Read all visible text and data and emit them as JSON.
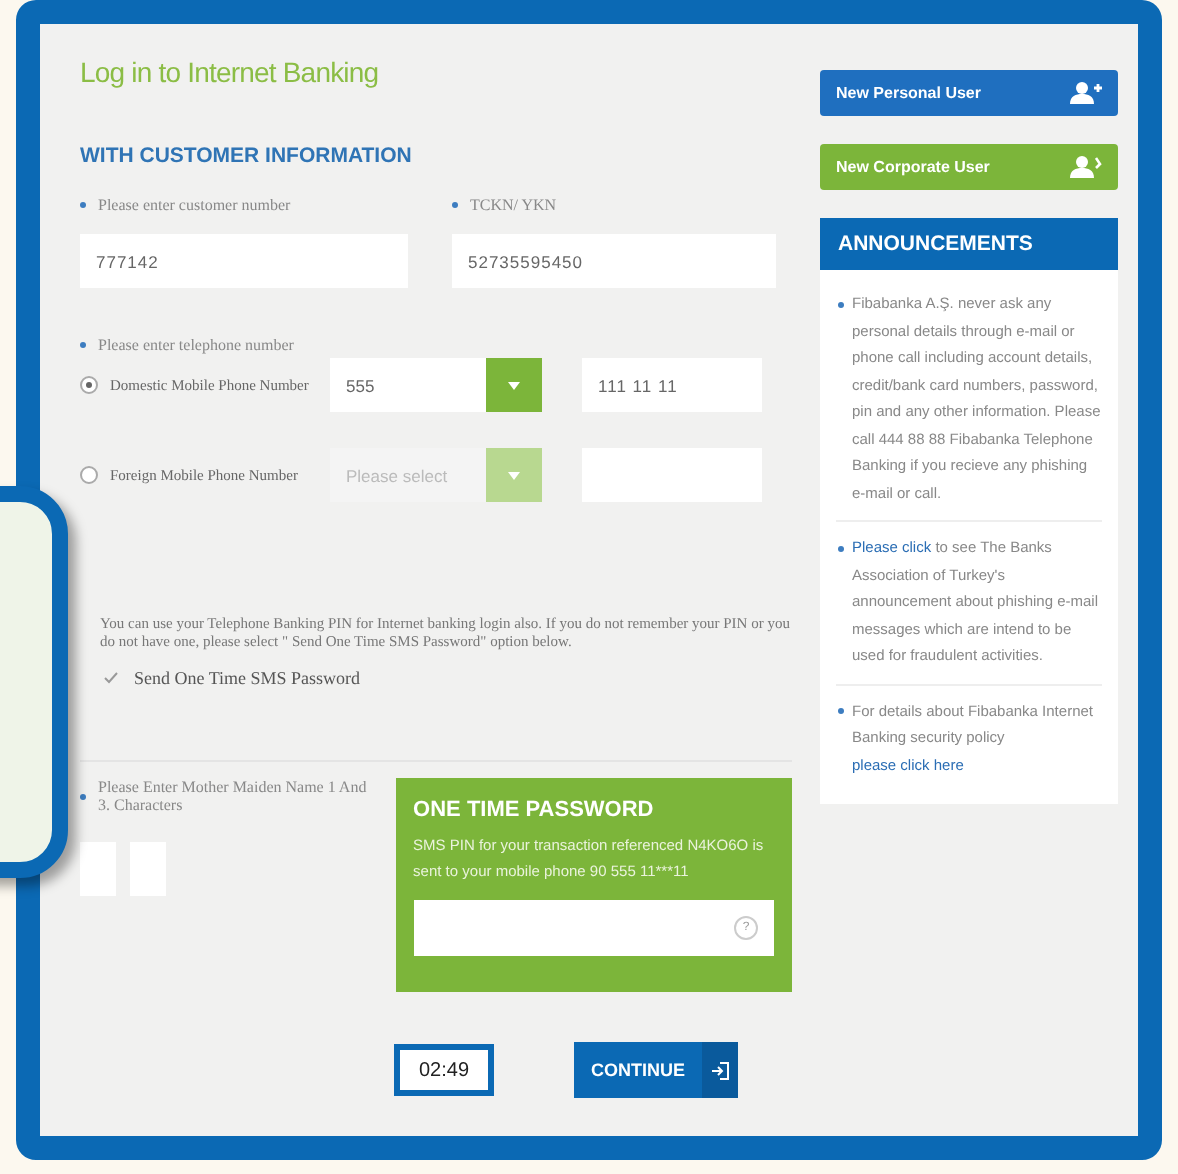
{
  "title": "Log in to Internet Banking",
  "section_heading": "WITH CUSTOMER INFORMATION",
  "customer_fields": [
    {
      "label": "Please enter customer number",
      "value": "777142"
    },
    {
      "label": "TCKN/ YKN",
      "value": "52735595450"
    }
  ],
  "phone_label": "Please enter telephone number",
  "phone_options": [
    {
      "label": "Domestic Mobile Phone Number",
      "selected": true,
      "prefix": "555",
      "number": "111 11 11"
    },
    {
      "label": "Foreign Mobile Phone Number",
      "selected": false,
      "prefix_placeholder": "Please select"
    }
  ],
  "note": "You can use your Telephone Banking PIN for Internet banking login also. If you do not remember your PIN or you do not have one, please select \" Send One Time SMS Password\" option below.",
  "sms_option": {
    "label": "Send One Time SMS Password",
    "checked": true
  },
  "maiden_name_label": "Please Enter Mother Maiden Name 1 And 3. Characters",
  "otp": {
    "title": "ONE TIME PASSWORD",
    "message": "SMS PIN for your transaction referenced N4KO6O is sent to your mobile phone 90 555 11***11",
    "help": "?"
  },
  "timer": "02:49",
  "continue": "CONTINUE",
  "sidebar_buttons": [
    {
      "label": "New Personal User",
      "kind": "personal"
    },
    {
      "label": "New Corporate User",
      "kind": "corporate"
    }
  ],
  "announcements": {
    "title": "ANNOUNCEMENTS",
    "items": [
      {
        "parts": [
          {
            "kind": "text",
            "text": "Fibabanka A.Ş. never ask any personal details through e-mail or phone call including account details, credit/bank card numbers, password, pin and any other information. Please call 444 88 88 Fibabanka Telephone Banking if you recieve any phishing e-mail or call."
          }
        ]
      },
      {
        "parts": [
          {
            "kind": "link",
            "text": "Please click"
          },
          {
            "kind": "text",
            "text": " to see The Banks Association of Turkey's announcement about phishing e-mail messages which are intend to be used for fraudulent activities."
          }
        ]
      },
      {
        "parts": [
          {
            "kind": "text",
            "text": "For details about Fibabanka Internet Banking security policy "
          },
          {
            "kind": "link",
            "text": "please click here"
          }
        ]
      }
    ]
  }
}
